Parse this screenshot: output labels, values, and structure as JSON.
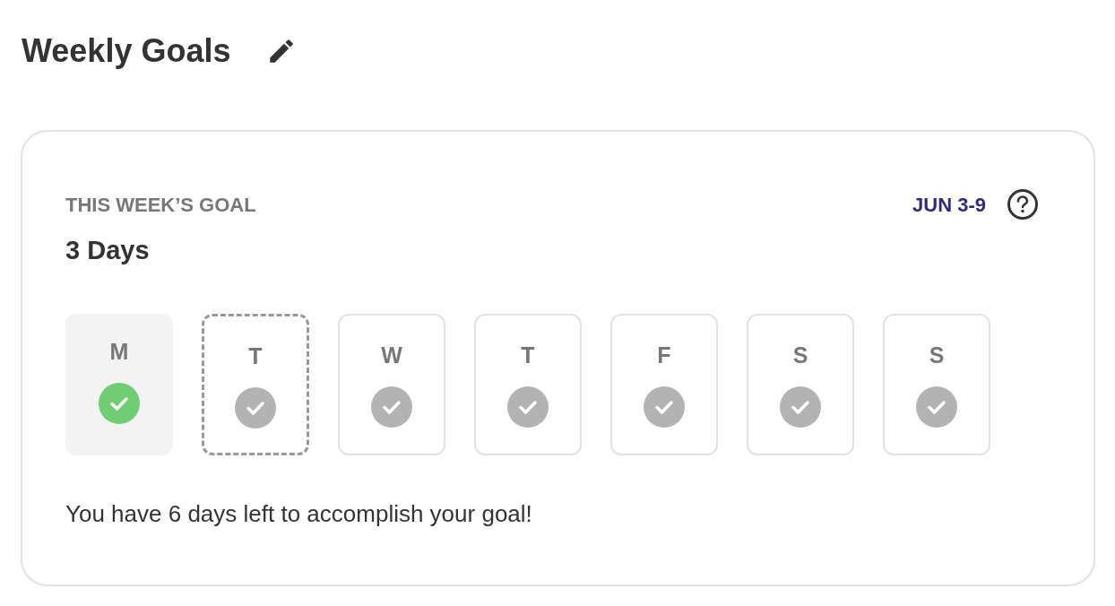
{
  "title": "Weekly Goals",
  "card": {
    "label": "THIS WEEK’S GOAL",
    "date_range": "JUN 3-9",
    "goal": "3 Days",
    "days": [
      {
        "letter": "M",
        "completed": true,
        "today": false
      },
      {
        "letter": "T",
        "completed": false,
        "today": true
      },
      {
        "letter": "W",
        "completed": false,
        "today": false
      },
      {
        "letter": "T",
        "completed": false,
        "today": false
      },
      {
        "letter": "F",
        "completed": false,
        "today": false
      },
      {
        "letter": "S",
        "completed": false,
        "today": false
      },
      {
        "letter": "S",
        "completed": false,
        "today": false
      }
    ],
    "message": "You have 6 days left to accomplish your goal!"
  }
}
